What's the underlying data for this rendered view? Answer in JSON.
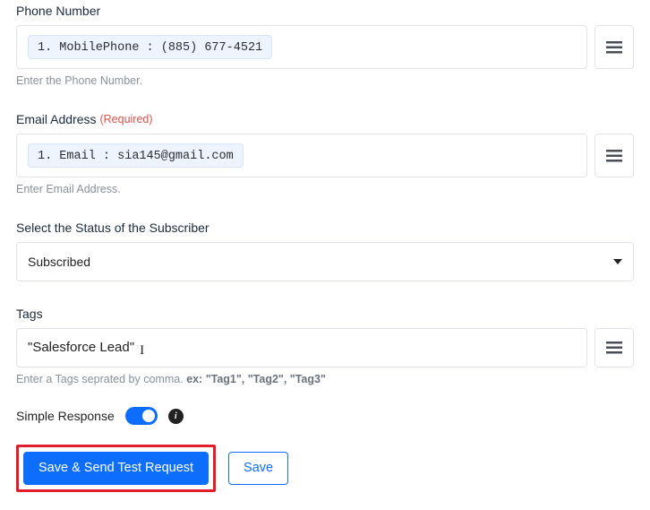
{
  "phone": {
    "label": "Phone Number",
    "chip": "1. MobilePhone : (885) 677-4521",
    "help": "Enter the Phone Number."
  },
  "email": {
    "label": "Email Address",
    "required": "(Required)",
    "chip": "1. Email : sia145@gmail.com",
    "help": "Enter Email Address."
  },
  "status": {
    "label": "Select the Status of the Subscriber",
    "value": "Subscribed"
  },
  "tags": {
    "label": "Tags",
    "value": "\"Salesforce Lead\"",
    "help_prefix": "Enter a Tags seprated by comma. ",
    "help_example_label": "ex:",
    "help_example_value": " \"Tag1\", \"Tag2\", \"Tag3\""
  },
  "simple_response": {
    "label": "Simple Response",
    "enabled": true
  },
  "buttons": {
    "primary": "Save & Send Test Request",
    "secondary": "Save"
  }
}
